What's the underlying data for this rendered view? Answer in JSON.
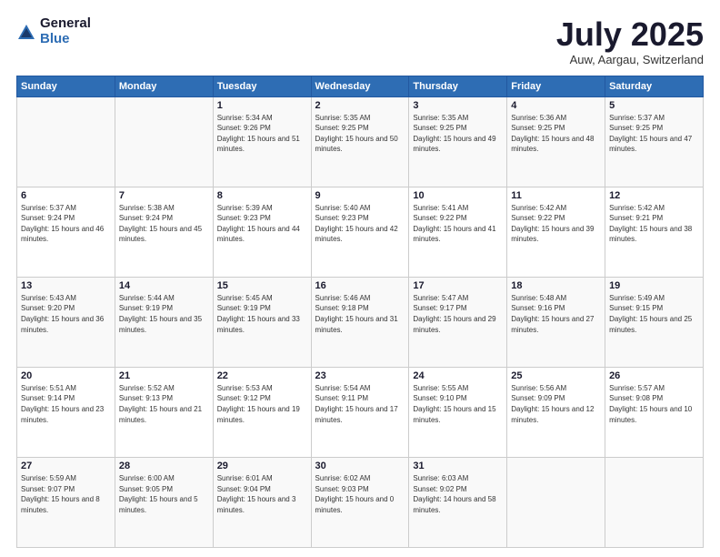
{
  "header": {
    "logo_general": "General",
    "logo_blue": "Blue",
    "month_title": "July 2025",
    "location": "Auw, Aargau, Switzerland"
  },
  "weekdays": [
    "Sunday",
    "Monday",
    "Tuesday",
    "Wednesday",
    "Thursday",
    "Friday",
    "Saturday"
  ],
  "weeks": [
    [
      {
        "day": "",
        "sunrise": "",
        "sunset": "",
        "daylight": ""
      },
      {
        "day": "",
        "sunrise": "",
        "sunset": "",
        "daylight": ""
      },
      {
        "day": "1",
        "sunrise": "Sunrise: 5:34 AM",
        "sunset": "Sunset: 9:26 PM",
        "daylight": "Daylight: 15 hours and 51 minutes."
      },
      {
        "day": "2",
        "sunrise": "Sunrise: 5:35 AM",
        "sunset": "Sunset: 9:25 PM",
        "daylight": "Daylight: 15 hours and 50 minutes."
      },
      {
        "day": "3",
        "sunrise": "Sunrise: 5:35 AM",
        "sunset": "Sunset: 9:25 PM",
        "daylight": "Daylight: 15 hours and 49 minutes."
      },
      {
        "day": "4",
        "sunrise": "Sunrise: 5:36 AM",
        "sunset": "Sunset: 9:25 PM",
        "daylight": "Daylight: 15 hours and 48 minutes."
      },
      {
        "day": "5",
        "sunrise": "Sunrise: 5:37 AM",
        "sunset": "Sunset: 9:25 PM",
        "daylight": "Daylight: 15 hours and 47 minutes."
      }
    ],
    [
      {
        "day": "6",
        "sunrise": "Sunrise: 5:37 AM",
        "sunset": "Sunset: 9:24 PM",
        "daylight": "Daylight: 15 hours and 46 minutes."
      },
      {
        "day": "7",
        "sunrise": "Sunrise: 5:38 AM",
        "sunset": "Sunset: 9:24 PM",
        "daylight": "Daylight: 15 hours and 45 minutes."
      },
      {
        "day": "8",
        "sunrise": "Sunrise: 5:39 AM",
        "sunset": "Sunset: 9:23 PM",
        "daylight": "Daylight: 15 hours and 44 minutes."
      },
      {
        "day": "9",
        "sunrise": "Sunrise: 5:40 AM",
        "sunset": "Sunset: 9:23 PM",
        "daylight": "Daylight: 15 hours and 42 minutes."
      },
      {
        "day": "10",
        "sunrise": "Sunrise: 5:41 AM",
        "sunset": "Sunset: 9:22 PM",
        "daylight": "Daylight: 15 hours and 41 minutes."
      },
      {
        "day": "11",
        "sunrise": "Sunrise: 5:42 AM",
        "sunset": "Sunset: 9:22 PM",
        "daylight": "Daylight: 15 hours and 39 minutes."
      },
      {
        "day": "12",
        "sunrise": "Sunrise: 5:42 AM",
        "sunset": "Sunset: 9:21 PM",
        "daylight": "Daylight: 15 hours and 38 minutes."
      }
    ],
    [
      {
        "day": "13",
        "sunrise": "Sunrise: 5:43 AM",
        "sunset": "Sunset: 9:20 PM",
        "daylight": "Daylight: 15 hours and 36 minutes."
      },
      {
        "day": "14",
        "sunrise": "Sunrise: 5:44 AM",
        "sunset": "Sunset: 9:19 PM",
        "daylight": "Daylight: 15 hours and 35 minutes."
      },
      {
        "day": "15",
        "sunrise": "Sunrise: 5:45 AM",
        "sunset": "Sunset: 9:19 PM",
        "daylight": "Daylight: 15 hours and 33 minutes."
      },
      {
        "day": "16",
        "sunrise": "Sunrise: 5:46 AM",
        "sunset": "Sunset: 9:18 PM",
        "daylight": "Daylight: 15 hours and 31 minutes."
      },
      {
        "day": "17",
        "sunrise": "Sunrise: 5:47 AM",
        "sunset": "Sunset: 9:17 PM",
        "daylight": "Daylight: 15 hours and 29 minutes."
      },
      {
        "day": "18",
        "sunrise": "Sunrise: 5:48 AM",
        "sunset": "Sunset: 9:16 PM",
        "daylight": "Daylight: 15 hours and 27 minutes."
      },
      {
        "day": "19",
        "sunrise": "Sunrise: 5:49 AM",
        "sunset": "Sunset: 9:15 PM",
        "daylight": "Daylight: 15 hours and 25 minutes."
      }
    ],
    [
      {
        "day": "20",
        "sunrise": "Sunrise: 5:51 AM",
        "sunset": "Sunset: 9:14 PM",
        "daylight": "Daylight: 15 hours and 23 minutes."
      },
      {
        "day": "21",
        "sunrise": "Sunrise: 5:52 AM",
        "sunset": "Sunset: 9:13 PM",
        "daylight": "Daylight: 15 hours and 21 minutes."
      },
      {
        "day": "22",
        "sunrise": "Sunrise: 5:53 AM",
        "sunset": "Sunset: 9:12 PM",
        "daylight": "Daylight: 15 hours and 19 minutes."
      },
      {
        "day": "23",
        "sunrise": "Sunrise: 5:54 AM",
        "sunset": "Sunset: 9:11 PM",
        "daylight": "Daylight: 15 hours and 17 minutes."
      },
      {
        "day": "24",
        "sunrise": "Sunrise: 5:55 AM",
        "sunset": "Sunset: 9:10 PM",
        "daylight": "Daylight: 15 hours and 15 minutes."
      },
      {
        "day": "25",
        "sunrise": "Sunrise: 5:56 AM",
        "sunset": "Sunset: 9:09 PM",
        "daylight": "Daylight: 15 hours and 12 minutes."
      },
      {
        "day": "26",
        "sunrise": "Sunrise: 5:57 AM",
        "sunset": "Sunset: 9:08 PM",
        "daylight": "Daylight: 15 hours and 10 minutes."
      }
    ],
    [
      {
        "day": "27",
        "sunrise": "Sunrise: 5:59 AM",
        "sunset": "Sunset: 9:07 PM",
        "daylight": "Daylight: 15 hours and 8 minutes."
      },
      {
        "day": "28",
        "sunrise": "Sunrise: 6:00 AM",
        "sunset": "Sunset: 9:05 PM",
        "daylight": "Daylight: 15 hours and 5 minutes."
      },
      {
        "day": "29",
        "sunrise": "Sunrise: 6:01 AM",
        "sunset": "Sunset: 9:04 PM",
        "daylight": "Daylight: 15 hours and 3 minutes."
      },
      {
        "day": "30",
        "sunrise": "Sunrise: 6:02 AM",
        "sunset": "Sunset: 9:03 PM",
        "daylight": "Daylight: 15 hours and 0 minutes."
      },
      {
        "day": "31",
        "sunrise": "Sunrise: 6:03 AM",
        "sunset": "Sunset: 9:02 PM",
        "daylight": "Daylight: 14 hours and 58 minutes."
      },
      {
        "day": "",
        "sunrise": "",
        "sunset": "",
        "daylight": ""
      },
      {
        "day": "",
        "sunrise": "",
        "sunset": "",
        "daylight": ""
      }
    ]
  ]
}
